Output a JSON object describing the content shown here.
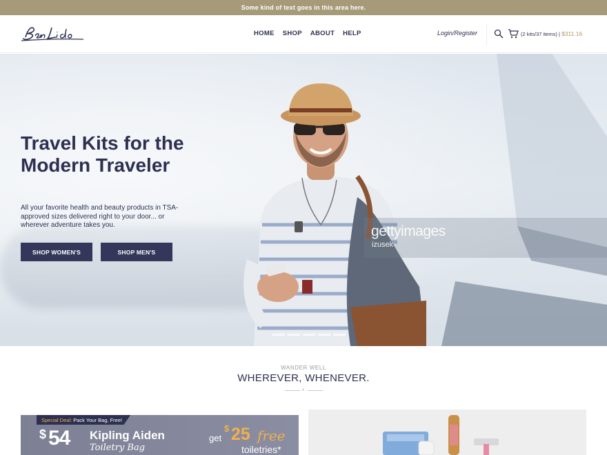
{
  "announcement": "Some kind of text goes in this area here.",
  "logo_text": "BenLido",
  "nav": [
    "HOME",
    "SHOP",
    "ABOUT",
    "HELP"
  ],
  "login": "Login/Register",
  "cart": {
    "items": "(2 kits/37 items)",
    "separator": "|",
    "total": "$311.16"
  },
  "hero": {
    "title": "Travel Kits for the Modern Traveler",
    "subtitle": "All your favorite health and beauty products in TSA-approved sizes delivered right to your door... or wherever adventure takes you.",
    "btn_women": "SHOP WOMEN'S",
    "btn_men": "SHOP MEN'S",
    "watermark_brand": "gettyimages",
    "watermark_credit": "izusek"
  },
  "section": {
    "eyebrow": "WANDER WELL",
    "heading": "WHEREVER, WHENEVER.",
    "divider_mark": "×"
  },
  "promo": {
    "badge_deal": "Special Deal:",
    "badge_text": "Pack Your Bag, Free!",
    "dollar": "$",
    "price": "54",
    "name": "Kipling Aiden",
    "sub": "Toiletry Bag",
    "get": "get",
    "offer_dollar": "$",
    "offer_amount": "25",
    "offer_free": "free",
    "offer_toiletries": "toiletries*"
  },
  "colors": {
    "topbar": "#a69a78",
    "navy": "#33385a",
    "price_gold": "#b49a5c",
    "offer_orange": "#f0b14a"
  }
}
